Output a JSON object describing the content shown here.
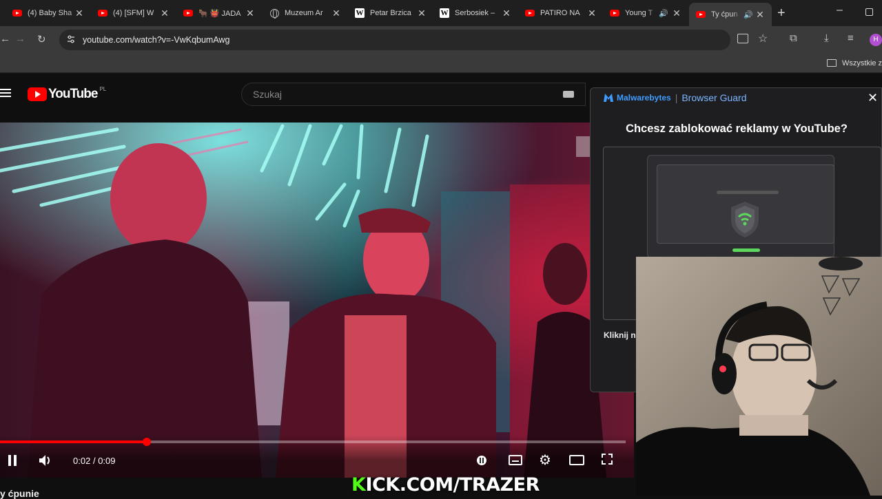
{
  "browser": {
    "tabs": [
      {
        "title": "(4) Baby Sha",
        "favicon": "youtube-icon",
        "active": false
      },
      {
        "title": "(4) [SFM] W",
        "favicon": "youtube-icon",
        "active": false
      },
      {
        "title": "🐂 👹 JADA",
        "favicon": "youtube-icon",
        "active": false
      },
      {
        "title": "Muzeum Ar",
        "favicon": "globe-icon",
        "active": false
      },
      {
        "title": "Petar Brzica",
        "favicon": "wikipedia-icon",
        "active": false
      },
      {
        "title": "Serbosiek –",
        "favicon": "wikipedia-icon",
        "active": false
      },
      {
        "title": "PATIRO NA",
        "favicon": "youtube-icon",
        "active": false
      },
      {
        "title": "Young T",
        "favicon": "youtube-icon",
        "active": false,
        "audio": true
      },
      {
        "title": "Ty ćpun",
        "favicon": "youtube-icon",
        "active": true,
        "audio": true
      }
    ],
    "url": "youtube.com/watch?v=-VwKqbumAwg",
    "bookmarks_label": "Wszystkie za",
    "profile_initial": "H"
  },
  "youtube": {
    "logo_text": "YouTube",
    "region": "PL",
    "search_placeholder": "Szukaj",
    "video_title_partial": "y ćpunie"
  },
  "player": {
    "time_current": "0:02",
    "time_separator": "/",
    "time_total": "0:09",
    "progress_fraction": 0.235
  },
  "malwarebytes": {
    "brand": "Malwarebytes",
    "product": "Browser Guard",
    "question": "Chcesz zablokować reklamy w YouTube?",
    "footer_partial": "Kliknij n"
  },
  "overlay": {
    "kick_k": "K",
    "kick_rest": "ICK.COM/TRAZER"
  },
  "colors": {
    "youtube_red": "#ff0000",
    "kick_green": "#53fc18",
    "malwarebytes_blue": "#3f9dff",
    "shield_green": "#5cd65c"
  }
}
